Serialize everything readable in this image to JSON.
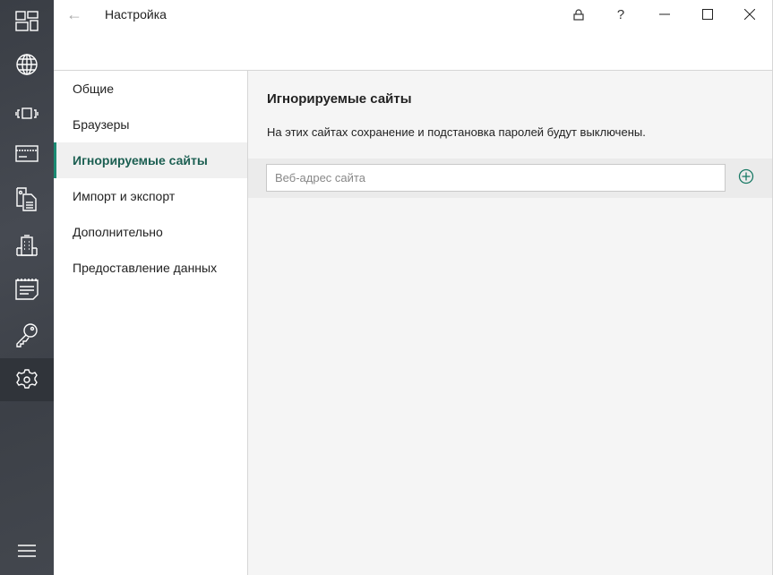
{
  "window": {
    "title": "Настройка",
    "back_icon": "arrow-left-icon"
  },
  "rail": {
    "items": [
      {
        "icon": "dashboard-icon"
      },
      {
        "icon": "globe-icon"
      },
      {
        "icon": "scan-icon"
      },
      {
        "icon": "credit-card-icon"
      },
      {
        "icon": "documents-icon"
      },
      {
        "icon": "building-icon"
      },
      {
        "icon": "notes-icon"
      },
      {
        "icon": "key-icon"
      },
      {
        "icon": "gear-icon",
        "active": true
      }
    ],
    "menu_icon": "hamburger-icon"
  },
  "nav": {
    "items": [
      {
        "label": "Общие"
      },
      {
        "label": "Браузеры"
      },
      {
        "label": "Игнорируемые сайты",
        "active": true
      },
      {
        "label": "Импорт и экспорт"
      },
      {
        "label": "Дополнительно"
      },
      {
        "label": "Предоставление данных"
      }
    ]
  },
  "main": {
    "title": "Игнорируемые сайты",
    "description": "На этих сайтах сохранение и подстановка паролей будут выключены.",
    "input": {
      "value": "",
      "placeholder": "Веб-адрес сайта"
    }
  },
  "colors": {
    "accent": "#1a8a72",
    "rail": "#3f434a"
  }
}
